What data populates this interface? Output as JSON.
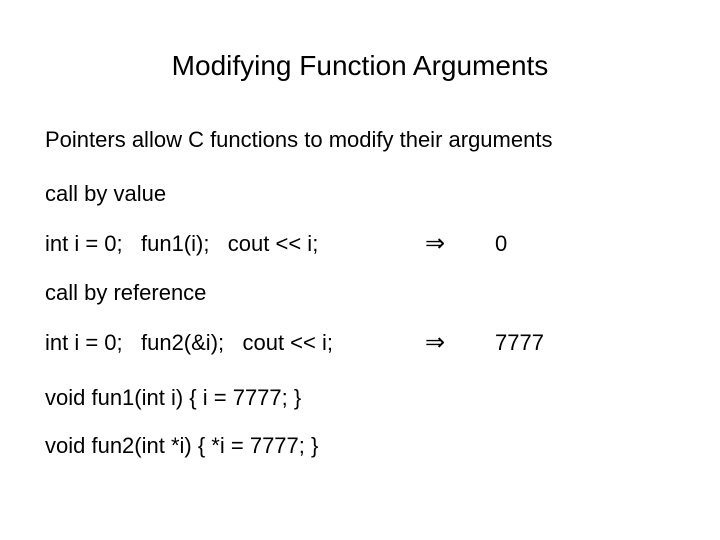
{
  "title": "Modifying Function Arguments",
  "intro": "Pointers allow C functions to modify their arguments",
  "call_by_value_label": "call by value",
  "example1_code": "int i = 0;   fun1(i);   cout << i;",
  "arrow": "⇒",
  "example1_result": "0",
  "call_by_reference_label": "call by reference",
  "example2_code": "int i = 0;   fun2(&i);   cout << i;",
  "example2_result": "7777",
  "fun1_def": "void fun1(int i) { i = 7777; }",
  "fun2_def": "void fun2(int *i) { *i = 7777; }"
}
